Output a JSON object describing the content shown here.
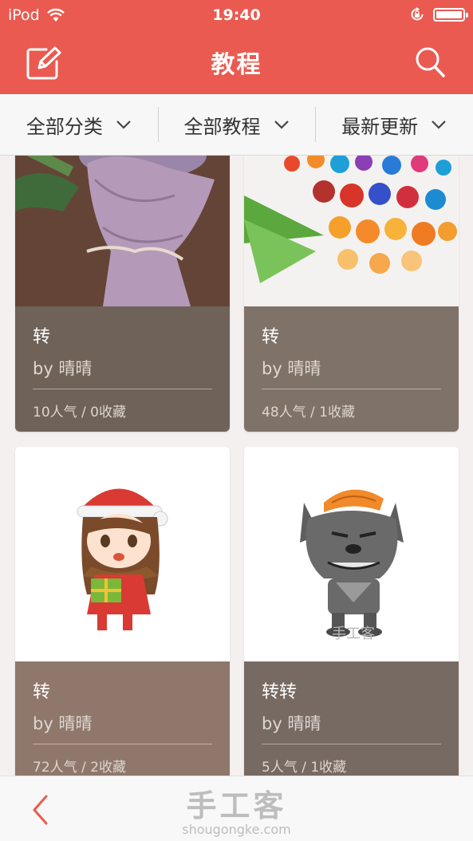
{
  "status_bar": {
    "carrier": "iPod",
    "time": "19:40"
  },
  "header": {
    "title": "教程",
    "accent": "#ea5a50"
  },
  "filters": [
    {
      "label": "全部分类"
    },
    {
      "label": "全部教程"
    },
    {
      "label": "最新更新"
    }
  ],
  "cards": [
    {
      "title": "转",
      "author": "by 晴晴",
      "stats": "10人气 / 0收藏",
      "info_color": "#6e6259",
      "image": "bouquet"
    },
    {
      "title": "转",
      "author": "by 晴晴",
      "stats": "48人气 / 1收藏",
      "info_color": "#7f7268",
      "image": "paper-quill-flowers"
    },
    {
      "title": "转",
      "author": "by 晴晴",
      "stats": "72人气 / 2收藏",
      "info_color": "#8f776b",
      "image": "christmas-girl"
    },
    {
      "title": "转转",
      "author": "by 晴晴",
      "stats": "5人气 / 1收藏",
      "info_color": "#766a62",
      "image": "grey-wolf",
      "watermark": "手工客"
    }
  ],
  "footer": {
    "logo_cn": "手工客",
    "logo_en": "shougongke.com"
  },
  "icons": [
    "wifi-icon",
    "lock-rotation-icon",
    "battery-icon",
    "edit-icon",
    "search-icon",
    "chevron-down-icon",
    "back-chevron-icon"
  ]
}
